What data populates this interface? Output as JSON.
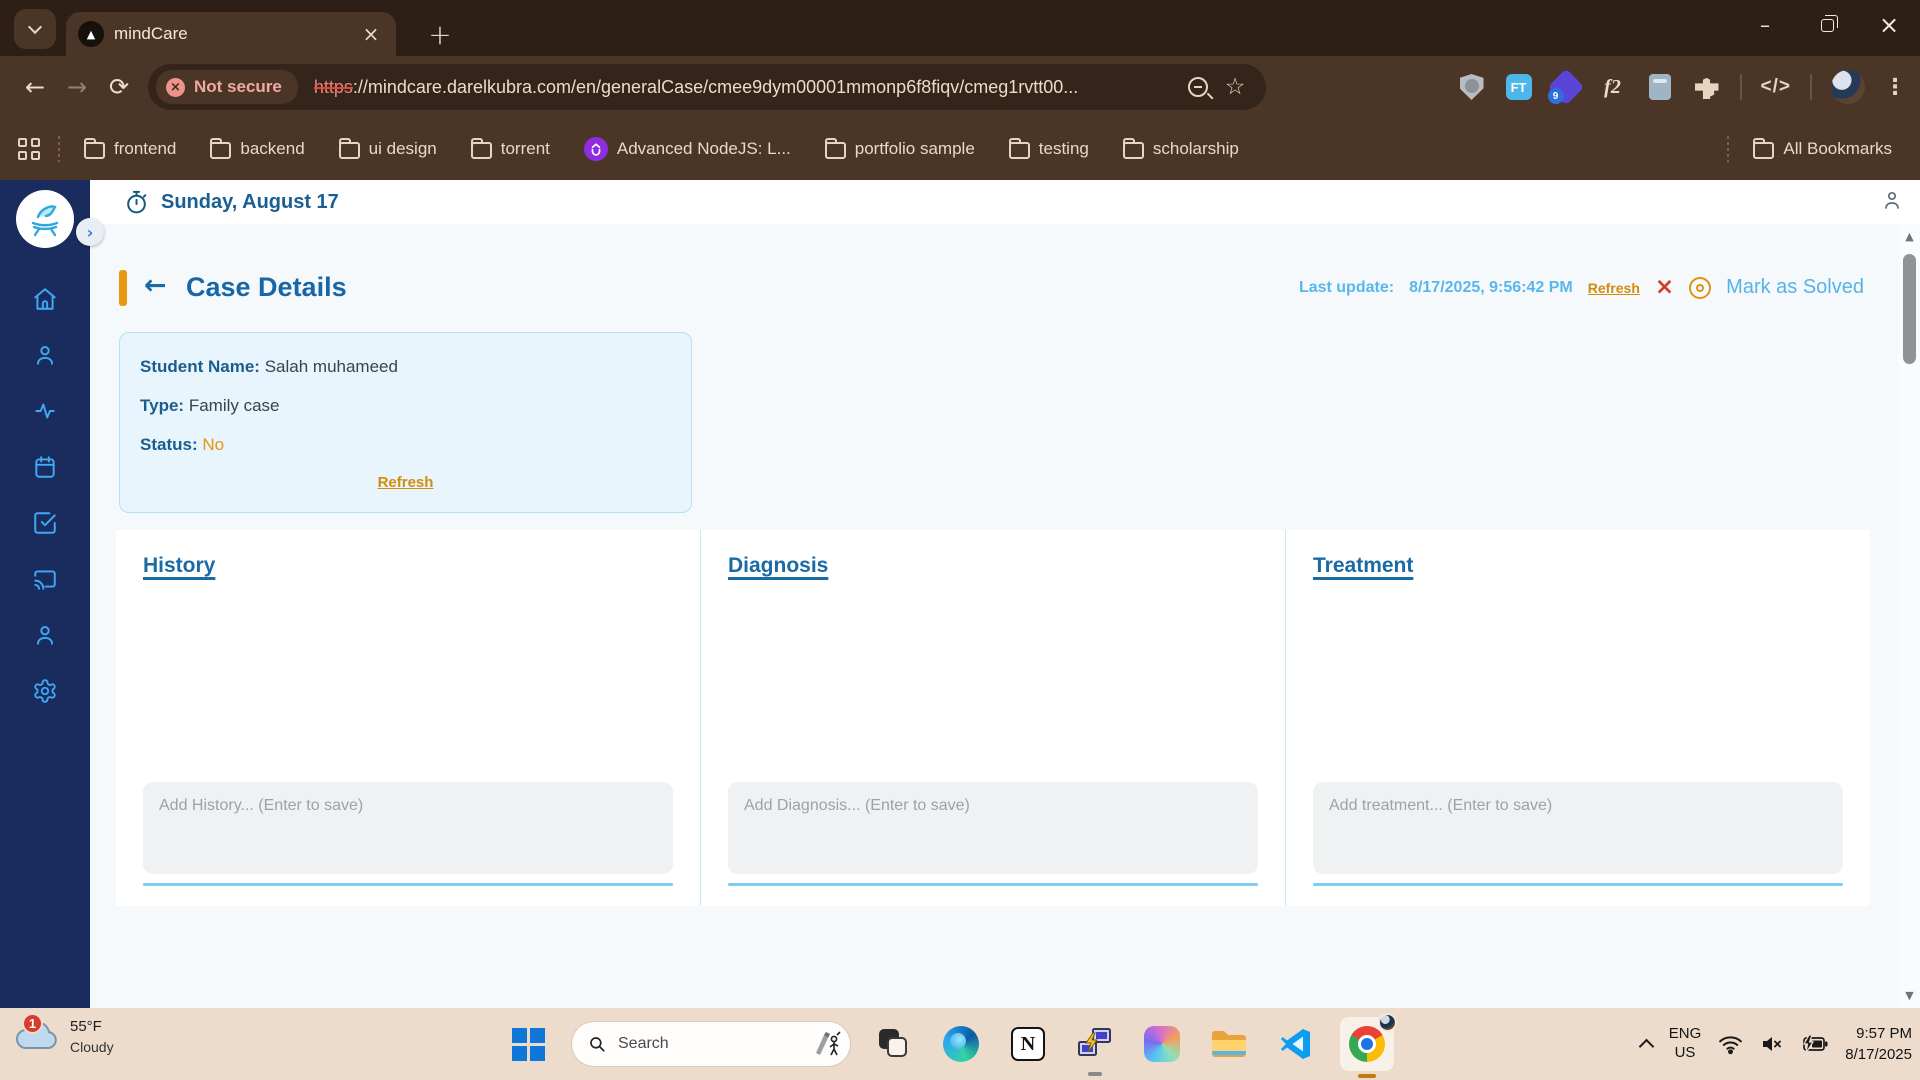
{
  "browser": {
    "tab_title": "mindCare",
    "tab_favicon_glyph": "▲",
    "close_tab_glyph": "×",
    "new_tab_glyph": "+",
    "minimize_glyph": "–",
    "close_window_glyph": "×",
    "back_glyph": "←",
    "forward_glyph": "→",
    "reload_glyph": "⟳",
    "star_glyph": "☆",
    "kebab_glyph": "⋮",
    "code_glyph": "</>",
    "not_secure_icon_glyph": "×",
    "not_secure_label": "Not secure",
    "url_scheme": "https",
    "url_rest": "://mindcare.darelkubra.com/en/generalCase/cmee9dym00001mmonp6f8fiqv/cmeg1rvtt00...",
    "extensions": {
      "ft_label": "FT",
      "purple_badge": "9",
      "fx_label": "f2"
    },
    "bookmarks": [
      {
        "label": "frontend"
      },
      {
        "label": "backend"
      },
      {
        "label": "ui design"
      },
      {
        "label": "torrent"
      },
      {
        "label": "Advanced NodeJS: L..."
      },
      {
        "label": "portfolio sample"
      },
      {
        "label": "testing"
      },
      {
        "label": "scholarship"
      }
    ],
    "all_bookmarks_label": "All Bookmarks"
  },
  "app": {
    "date_header": "Sunday, August 17",
    "sidebar_toggle_glyph": "›",
    "case": {
      "back_glyph": "←",
      "title": "Case Details",
      "last_update_label": "Last update:",
      "last_update_value": "8/17/2025, 9:56:42 PM",
      "refresh_label": "Refresh",
      "close_glyph": "×",
      "mark_as_solved_label": "Mark as Solved",
      "student_name_label": "Student Name:",
      "student_name_value": "Salah muhameed",
      "type_label": "Type:",
      "type_value": "Family case",
      "status_label": "Status:",
      "status_value": "No",
      "card_refresh_label": "Refresh"
    },
    "columns": [
      {
        "title": "History",
        "placeholder": "Add History... (Enter to save)"
      },
      {
        "title": "Diagnosis",
        "placeholder": "Add Diagnosis... (Enter to save)"
      },
      {
        "title": "Treatment",
        "placeholder": "Add treatment... (Enter to save)"
      }
    ],
    "scrollbar": {
      "up_glyph": "▲",
      "down_glyph": "▼"
    }
  },
  "taskbar": {
    "weather_badge": "1",
    "weather_temp": "55°F",
    "weather_condition": "Cloudy",
    "search_label": "Search",
    "notion_label": "N",
    "lang_line1": "ENG",
    "lang_line2": "US",
    "time": "9:57 PM",
    "date": "8/17/2025"
  },
  "colors": {
    "titlebar_brown": "#2d1f15",
    "toolbar_brown": "#4a3527",
    "omnibox_brown": "#342419",
    "sidebar_navy": "#1a2c5e",
    "sidebar_icon_blue": "#3fa9f5",
    "primary_blue": "#1a6aa5",
    "light_blue_text": "#58b7ea",
    "accent_orange": "#e8950c",
    "link_orange": "#d28d0a",
    "error_red": "#d43c2a",
    "card_bg": "#e9f5fc",
    "card_border": "#b5dff2",
    "content_bg": "#f6f9fb",
    "taskbar_beige": "#eddccb"
  }
}
